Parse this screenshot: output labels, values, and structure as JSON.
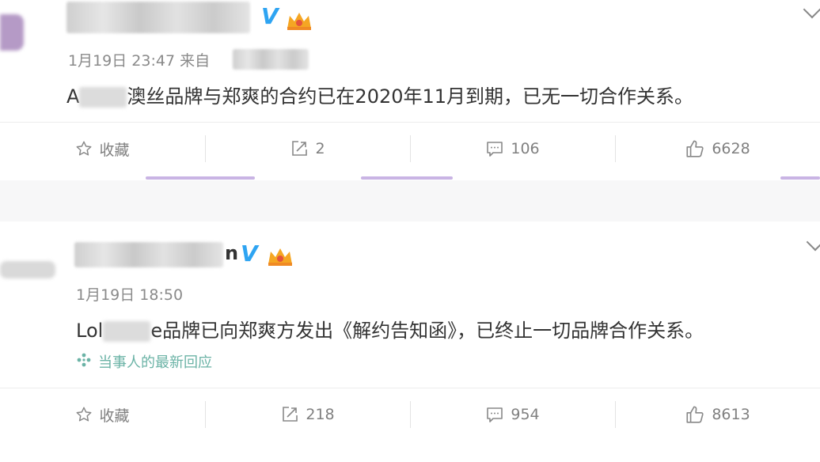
{
  "posts": [
    {
      "username_tail": "",
      "time": "1月19日 23:47 来自",
      "content_prefix": "A",
      "content_suffix": "澳丝品牌与郑爽的合约已在2020年11月到期，已无一切合作关系。",
      "actions": {
        "collect_label": "收藏",
        "repost_count": "2",
        "comment_count": "106",
        "like_count": "6628"
      }
    },
    {
      "username_tail": "n",
      "time": "1月19日 18:50",
      "content_prefix": "Lol",
      "content_suffix": "e品牌已向郑爽方发出《解约告知函》，已终止一切品牌合作关系。",
      "reply_label": "当事人的最新回应",
      "actions": {
        "collect_label": "收藏",
        "repost_count": "218",
        "comment_count": "954",
        "like_count": "8613"
      }
    }
  ],
  "badges": {
    "verified_letter": "V"
  },
  "colors": {
    "verified": "#2ea4f2",
    "reply": "#6bb3a6",
    "accent": "#c9b4e4"
  },
  "icons": [
    "star-icon",
    "repost-icon",
    "comment-icon",
    "like-icon",
    "crown-icon",
    "chevron-down-icon",
    "sparkle-icon"
  ]
}
